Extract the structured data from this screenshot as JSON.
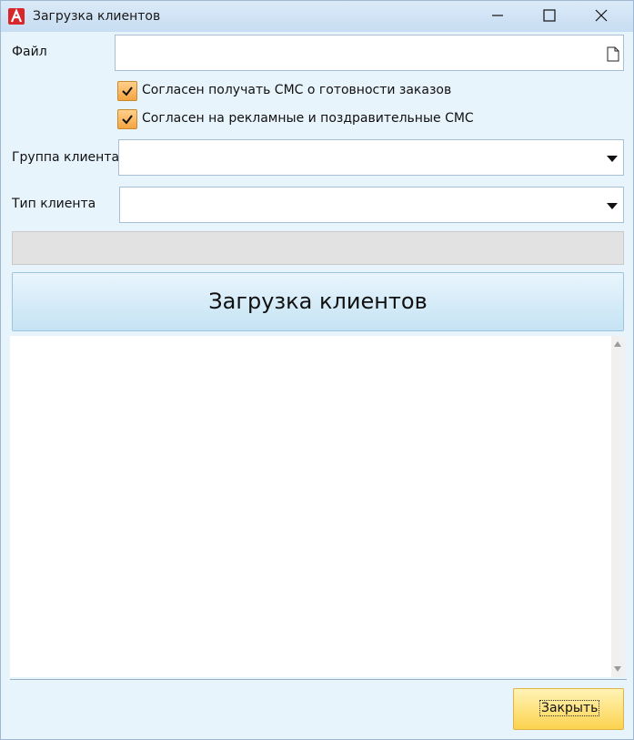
{
  "window": {
    "title": "Загрузка клиентов",
    "app_icon": "app-logo-icon",
    "accent": "#d9262b"
  },
  "form": {
    "file_label": "Файл",
    "file_value": "",
    "sms_ready_checked": true,
    "sms_ready_label": "Согласен получать СМС о готовности заказов",
    "sms_promo_checked": true,
    "sms_promo_label": "Согласен на рекламные и поздравительные СМС",
    "group_label": "Группа клиента",
    "group_value": "",
    "type_label": "Тип клиента",
    "type_value": ""
  },
  "progress": {
    "value": 0
  },
  "actions": {
    "load_label": "Загрузка клиентов",
    "close_label": "Закрыть"
  },
  "colors": {
    "background": "#e8f4fc",
    "checkbox": "#f5a442",
    "close_button": "#fcd34f",
    "load_button": "#c5e3f4"
  }
}
